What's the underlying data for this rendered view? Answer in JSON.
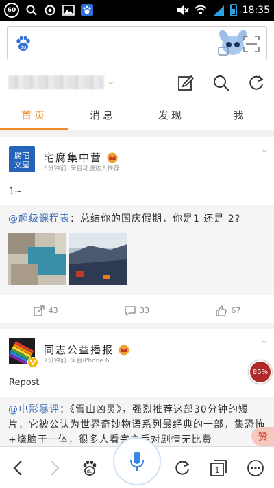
{
  "status_bar": {
    "badge": "60",
    "time": "18:35",
    "icons": [
      "search-icon",
      "settings-icon",
      "gallery-icon",
      "baidu-icon",
      "mute-icon",
      "wifi-icon",
      "signal-icon",
      "battery-icon"
    ]
  },
  "address_bar": {
    "logo": "baidu-paw-icon",
    "mascot": "mascot-icon",
    "scan": "scan-icon"
  },
  "toolbar": {
    "user_name": "",
    "icons": [
      "compose-icon",
      "search-icon",
      "refresh-icon"
    ]
  },
  "tabs": [
    {
      "label": "首页",
      "active": true
    },
    {
      "label": "消息",
      "active": false
    },
    {
      "label": "发现",
      "active": false
    },
    {
      "label": "我",
      "active": false
    }
  ],
  "posts": [
    {
      "author": "宅腐集中营",
      "avatar_text": "腐宅\n文屋",
      "time": "6分钟前",
      "source": "来自动漫达人推荐",
      "text": "1~",
      "repost_link": "@超级课程表",
      "repost_text": "：总结你的国庆假期，你是1 还是 2?",
      "actions": {
        "repost": "43",
        "comment": "33",
        "like": "67"
      }
    },
    {
      "author": "同志公益播报",
      "time": "7分钟前",
      "source": "来自iPhone 6",
      "text": "Repost",
      "repost_link": "@电影暴评",
      "repost_text": "：《雪山凶灵》，强烈推荐这部30分钟的短片，它被公认为世界奇妙物语系列最经典的一部，集恐怖+烧脑于一体，很多人看完之后对剧情无比费"
    }
  ],
  "float_badge": "85%",
  "float_side": "赞",
  "colors": {
    "accent": "#f08a24",
    "link": "#3b6fb6",
    "baidu_blue": "#2f6fdc"
  }
}
